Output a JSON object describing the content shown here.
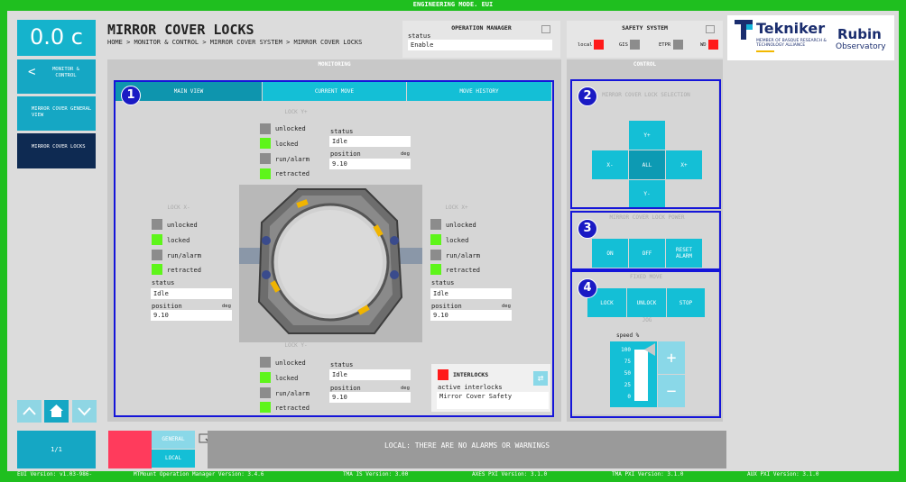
{
  "app_title": "ENGINEERING MODE. EUI",
  "clock": "0.0 c",
  "page_title": "MIRROR COVER LOCKS",
  "breadcrumb": "HOME > MONITOR & CONTROL > MIRROR COVER SYSTEM > MIRROR COVER LOCKS",
  "operation_manager": {
    "title": "OPERATION MANAGER",
    "status_label": "status",
    "status_value": "Enable"
  },
  "safety_system": {
    "title": "SAFETY SYSTEM",
    "local": "local",
    "gis": "GIS",
    "etpr": "ETPR",
    "wd": "WD"
  },
  "logos": {
    "tekniker": "Tekniker",
    "tekniker_sub": "MEMBER OF BASQUE RESEARCH & TECHNOLOGY ALLIANCE",
    "rubin_1": "Rubin",
    "rubin_2": "Observatory"
  },
  "sidebar": {
    "monitor_control": "MONITOR & CONTROL",
    "general_view": "MIRROR COVER GENERAL VIEW",
    "locks": "MIRROR COVER LOCKS",
    "page": "1/1"
  },
  "monitoring": {
    "header": "MONITORING",
    "tabs": [
      "MAIN VIEW",
      "CURRENT MOVE",
      "MOVE HISTORY"
    ],
    "lock_yplus": {
      "title": "LOCK Y+",
      "unlocked": "unlocked",
      "locked": "locked",
      "run_alarm": "run/alarm",
      "retracted": "retracted",
      "status_label": "status",
      "status": "Idle",
      "position_label": "position",
      "unit": "deg",
      "position": "9.10"
    },
    "lock_xminus": {
      "title": "LOCK X-",
      "unlocked": "unlocked",
      "locked": "locked",
      "run_alarm": "run/alarm",
      "retracted": "retracted",
      "status_label": "status",
      "status": "Idle",
      "position_label": "position",
      "unit": "deg",
      "position": "9.10"
    },
    "lock_xplus": {
      "title": "LOCK X+",
      "unlocked": "unlocked",
      "locked": "locked",
      "run_alarm": "run/alarm",
      "retracted": "retracted",
      "status_label": "status",
      "status": "Idle",
      "position_label": "position",
      "unit": "deg",
      "position": "9.10"
    },
    "lock_yminus": {
      "title": "LOCK Y-",
      "unlocked": "unlocked",
      "locked": "locked",
      "run_alarm": "run/alarm",
      "retracted": "retracted",
      "status_label": "status",
      "status": "Idle",
      "position_label": "position",
      "unit": "deg",
      "position": "9.10"
    },
    "interlocks": {
      "title": "INTERLOCKS",
      "active_label": "active interlocks",
      "value": "Mirror Cover Safety"
    }
  },
  "control": {
    "header": "CONTROL",
    "selection_title": "MIRROR COVER LOCK SELECTION",
    "yplus": "Y+",
    "xminus": "X-",
    "all": "ALL",
    "xplus": "X+",
    "yminus": "Y-",
    "power_title": "MIRROR COVER LOCK POWER",
    "on": "ON",
    "off": "OFF",
    "reset": "RESET ALARM",
    "fixed_title": "FIXED MOVE",
    "lock": "LOCK",
    "unlock": "UNLOCK",
    "stop": "STOP",
    "jog_title": "JOG",
    "speed_label": "speed %",
    "ticks": [
      "100",
      "75",
      "50",
      "25",
      "0"
    ],
    "speed_value": 100,
    "plus": "+",
    "minus": "−"
  },
  "badges": [
    "1",
    "2",
    "3",
    "4"
  ],
  "bottom": {
    "general": "GENERAL",
    "local": "LOCAL",
    "message": "LOCAL: THERE ARE NO ALARMS OR WARNINGS"
  },
  "footer": {
    "eui": "EUI Version: v1.03-986-",
    "mtmount": "MTMount Operation Manager Version: 3.4.6",
    "tma_is": "TMA IS Version: 3.00",
    "axes": "AXES PXI Version: 3.1.0",
    "tma_pxi": "TMA PXI Version: 3.1.0",
    "aux": "AUX PXI Version: 3.1.0"
  },
  "colors": {
    "accent": "#15b3cc",
    "frame": "#1fbf1f",
    "highlight": "#1515d9",
    "alarm": "#ff3b5c"
  }
}
